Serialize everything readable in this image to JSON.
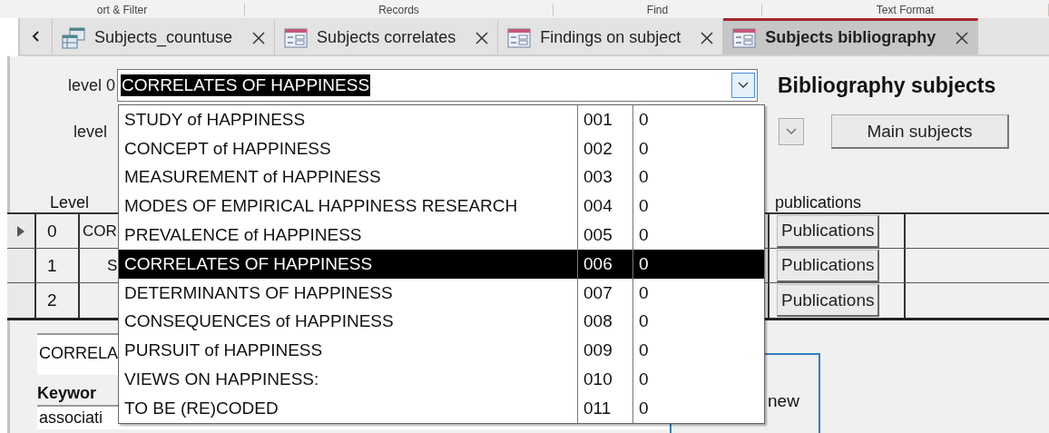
{
  "ribbon": {
    "groups": [
      {
        "label": "ort & Filter"
      },
      {
        "label": "Records"
      },
      {
        "label": "Find"
      },
      {
        "label": "Text Format"
      }
    ]
  },
  "tabs": [
    {
      "label": "Subjects_countuse",
      "kind": "query",
      "selected": false
    },
    {
      "label": "Subjects correlates",
      "kind": "form",
      "selected": false
    },
    {
      "label": "Findings on subject",
      "kind": "form",
      "selected": false
    },
    {
      "label": "Subjects bibliography",
      "kind": "form",
      "selected": true
    }
  ],
  "form": {
    "title": "Bibliography subjects",
    "level0": {
      "label": "level 0",
      "value": "CORRELATES OF HAPPINESS"
    },
    "level1": {
      "label": "level"
    },
    "main_button": "Main subjects",
    "table": {
      "level_header": "Level",
      "publications_header": "publications",
      "rows": [
        {
          "level": "0",
          "text": "COR",
          "indent": false,
          "button": "Publications",
          "current": true
        },
        {
          "level": "1",
          "text": "S",
          "indent": true,
          "button": "Publications",
          "current": false
        },
        {
          "level": "2",
          "button": "Publications",
          "current": false
        }
      ]
    },
    "description": "CORRELA",
    "keywords_label": "Keywor",
    "keywords": "associati",
    "box_text": "new"
  },
  "dropdown": {
    "items": [
      {
        "name": "STUDY of HAPPINESS",
        "code": "001",
        "count": "0",
        "selected": false
      },
      {
        "name": "CONCEPT of HAPPINESS",
        "code": "002",
        "count": "0",
        "selected": false
      },
      {
        "name": "MEASUREMENT of HAPPINESS",
        "code": "003",
        "count": "0",
        "selected": false
      },
      {
        "name": "MODES OF EMPIRICAL HAPPINESS RESEARCH",
        "code": "004",
        "count": "0",
        "selected": false
      },
      {
        "name": "PREVALENCE of HAPPINESS",
        "code": "005",
        "count": "0",
        "selected": false
      },
      {
        "name": "CORRELATES OF HAPPINESS",
        "code": "006",
        "count": "0",
        "selected": true
      },
      {
        "name": "DETERMINANTS OF HAPPINESS",
        "code": "007",
        "count": "0",
        "selected": false
      },
      {
        "name": "CONSEQUENCES of HAPPINESS",
        "code": "008",
        "count": "0",
        "selected": false
      },
      {
        "name": "PURSUIT of HAPPINESS",
        "code": "009",
        "count": "0",
        "selected": false
      },
      {
        "name": "VIEWS ON HAPPINESS:",
        "code": "010",
        "count": "0",
        "selected": false
      },
      {
        "name": "TO BE (RE)CODED",
        "code": "011",
        "count": "0",
        "selected": false
      }
    ]
  }
}
